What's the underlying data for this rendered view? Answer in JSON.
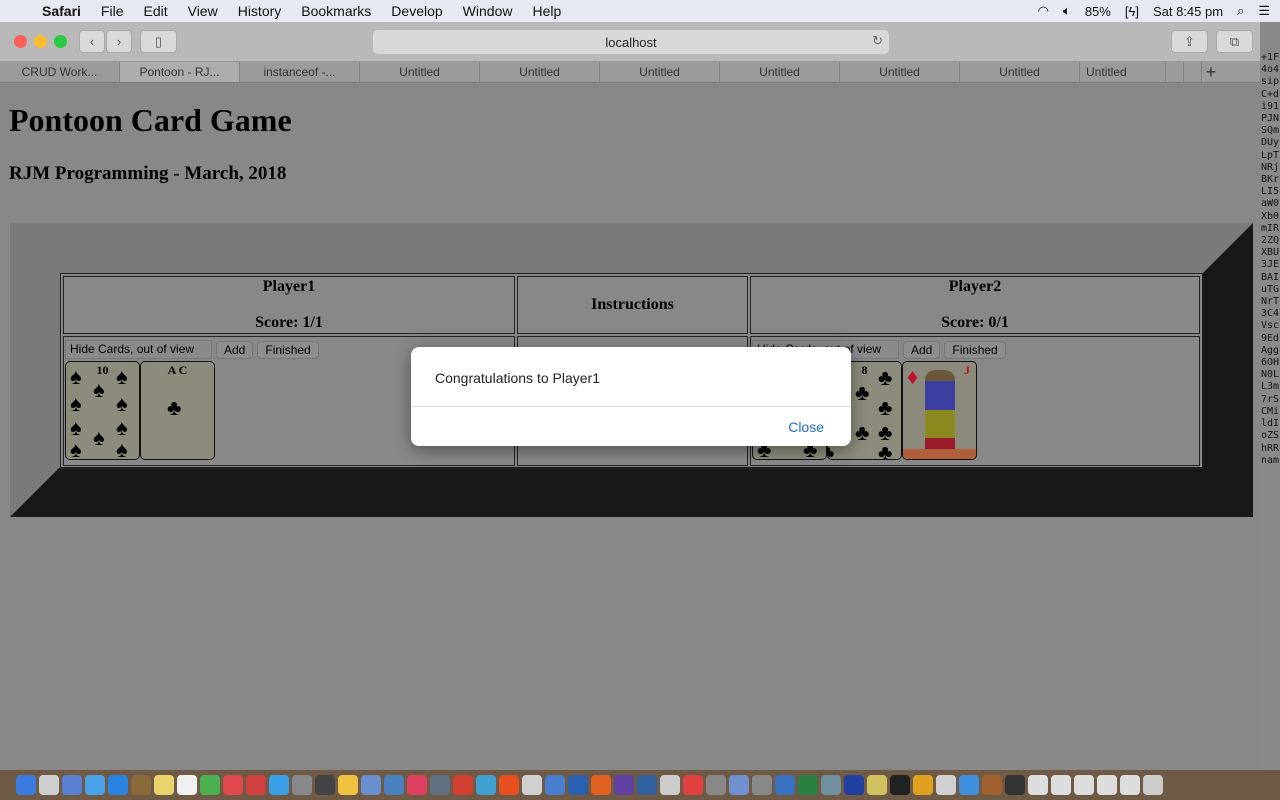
{
  "menubar": {
    "apple": "",
    "items": [
      "Safari",
      "File",
      "Edit",
      "View",
      "History",
      "Bookmarks",
      "Develop",
      "Window",
      "Help"
    ],
    "battery": "85%",
    "clock": "Sat 8:45 pm"
  },
  "browser": {
    "url": "localhost",
    "tabs": [
      "CRUD Work...",
      "Pontoon - RJ...",
      "instanceof -...",
      "Untitled",
      "Untitled",
      "Untitled",
      "Untitled",
      "Untitled",
      "Untitled",
      "Untitled"
    ],
    "active_tab": 1,
    "new_tab": "+"
  },
  "side_text": [
    "+1F",
    "4o4",
    "sip",
    "C+d",
    "i91",
    "PJN",
    "SQm",
    "DUy",
    "LpT",
    "NRj",
    "BKr",
    "LI5",
    "aW0",
    "Xb0",
    "mIR",
    "2ZQ",
    "XBU",
    "3JE",
    "BAI",
    "uTG",
    "NrT",
    "3C4",
    "Vsc",
    "9Ed",
    "Agg",
    "6OH",
    "N0L",
    "L3m",
    "7rS",
    "CMi",
    "ldI",
    "oZS",
    "hRR",
    "nam"
  ],
  "page": {
    "title": "Pontoon Card Game",
    "subtitle": "RJM Programming - March, 2018"
  },
  "game": {
    "player1": {
      "name": "Player1",
      "score": "Score: 1/1",
      "hide_value": "Hide Cards, out of view",
      "add": "Add",
      "finished": "Finished",
      "cards": [
        {
          "rank": "10",
          "suit": "spades",
          "label": "10"
        },
        {
          "rank": "A",
          "suit": "clubs",
          "label": "A  C"
        }
      ]
    },
    "instructions": "Instructions",
    "player2": {
      "name": "Player2",
      "score": "Score: 0/1",
      "hide_value": "Hide Cards, out of view",
      "add": "Add",
      "finished": "Finished",
      "cards": [
        {
          "rank": "?",
          "suit": "clubs",
          "label": ""
        },
        {
          "rank": "8",
          "suit": "clubs",
          "label": "8"
        },
        {
          "rank": "J",
          "suit": "diamonds",
          "label": "J"
        }
      ]
    }
  },
  "dialog": {
    "message": "Congratulations to Player1",
    "close": "Close"
  },
  "colors": {
    "link": "#1f6fd6",
    "red": "#c0102a"
  }
}
